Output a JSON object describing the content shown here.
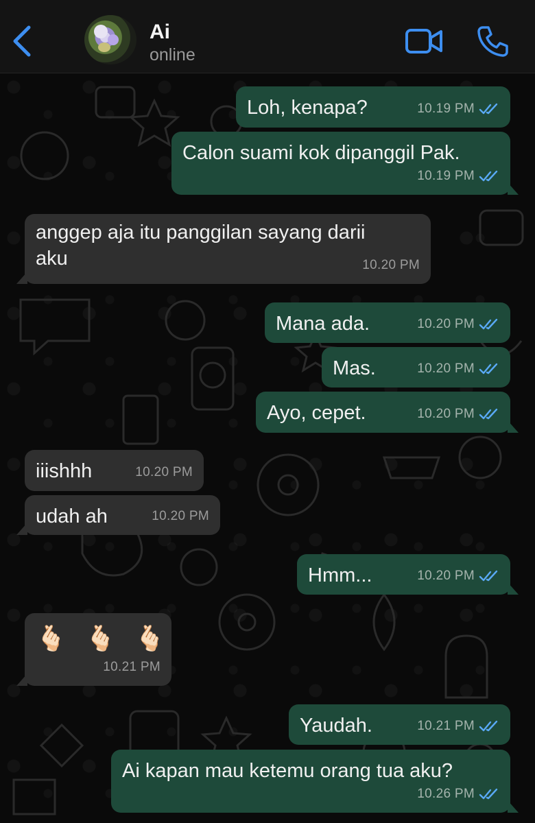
{
  "header": {
    "contact_name": "Ai",
    "contact_status": "online"
  },
  "messages": [
    {
      "direction": "out",
      "text": "Loh, kenapa?",
      "time": "10.19 PM",
      "status": "read"
    },
    {
      "direction": "out",
      "text": "Calon suami kok dipanggil Pak.",
      "time": "10.19 PM",
      "status": "read"
    },
    {
      "direction": "in",
      "text_line1": "anggep aja itu panggilan sayang darii",
      "text_line2": "aku",
      "time": "10.20 PM"
    },
    {
      "direction": "out",
      "text": "Mana ada.",
      "time": "10.20 PM",
      "status": "read"
    },
    {
      "direction": "out",
      "text": "Mas.",
      "time": "10.20 PM",
      "status": "read"
    },
    {
      "direction": "out",
      "text": "Ayo, cepet.",
      "time": "10.20 PM",
      "status": "read"
    },
    {
      "direction": "in",
      "text": "iiishhh",
      "time": "10.20 PM"
    },
    {
      "direction": "in",
      "text": "udah ah",
      "time": "10.20 PM"
    },
    {
      "direction": "out",
      "text": "Hmm...",
      "time": "10.20 PM",
      "status": "read"
    },
    {
      "direction": "in",
      "emojis": [
        "🫰🏻",
        "🫰🏻",
        "🫰🏻"
      ],
      "time": "10.21 PM"
    },
    {
      "direction": "out",
      "text": "Yaudah.",
      "time": "10.21 PM",
      "status": "read"
    },
    {
      "direction": "out",
      "text": "Ai kapan mau ketemu orang tua aku?",
      "time": "10.26 PM",
      "status": "read"
    }
  ],
  "icons": {
    "back": "chevron-left-icon",
    "video": "video-camera-icon",
    "call": "phone-icon",
    "read_receipt": "double-check-icon"
  },
  "colors": {
    "accent": "#3d8ef0",
    "outgoing_bubble": "#1e4a3a",
    "incoming_bubble": "#2f2f2f",
    "read_tick": "#5aa9f5"
  }
}
